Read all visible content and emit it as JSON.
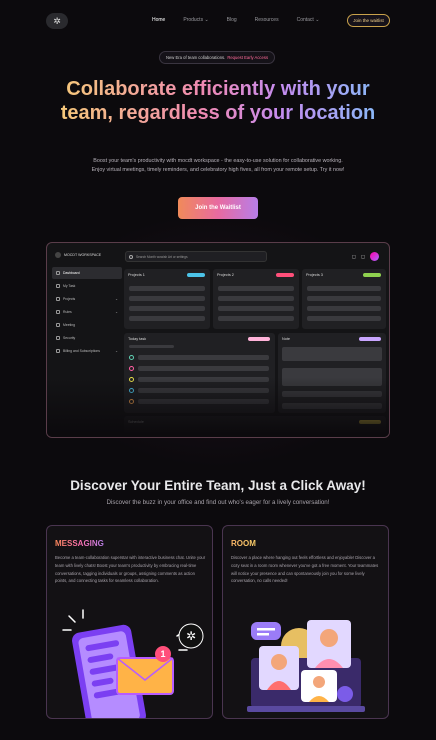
{
  "nav": {
    "logo_glyph": "✲",
    "links": [
      "Home",
      "Products ⌄",
      "Blog",
      "Resources",
      "Contact ⌄"
    ],
    "cta": "Join the waitlist"
  },
  "hero": {
    "pill_text": "New Era of team collaborations.",
    "pill_link": "Request Early Access",
    "title": "Collaborate efficiently with your team, regardless of your location",
    "subtitle": "Boost your team's productivity with mocdt workspace - the easy-to-use solution for collaborative working. Enjoy virtual meetings, timely reminders, and celebratory high fives, all from your remote setup. Try it now!",
    "cta": "Join the Waitlist"
  },
  "dashboard": {
    "workspace": "MOCDT WORKSPACE",
    "sidebar": [
      {
        "label": "Dashboard",
        "chev": ""
      },
      {
        "label": "My Task",
        "chev": ""
      },
      {
        "label": "Projects",
        "chev": "⌄"
      },
      {
        "label": "Rules",
        "chev": "⌄"
      },
      {
        "label": "Meeting",
        "chev": ""
      },
      {
        "label": "Security",
        "chev": ""
      },
      {
        "label": "Billing and Subscriptions",
        "chev": "⌄"
      }
    ],
    "search_placeholder": "Search Month wowish Art or settings",
    "projects": [
      {
        "title": "Projects 1",
        "color": "#4cc3e8"
      },
      {
        "title": "Projects 2",
        "color": "#ff4f7a"
      },
      {
        "title": "Projects 3",
        "color": "#8fd14f"
      }
    ],
    "today_task": "Today task",
    "note": "Note",
    "schedule": "Schedule",
    "today_tag_color": "#ffb3d9",
    "note_tag_color": "#c9a6ff",
    "schedule_tag_color": "#ffe14d",
    "task_dot_colors": [
      "#5fd1b3",
      "#ff5fa2",
      "#e8e04a",
      "#4cc3e8",
      "#f0a050"
    ]
  },
  "discover": {
    "title": "Discover Your Entire Team, Just a Click Away!",
    "subtitle": "Discover the buzz in your office and find out who's eager for a lively conversation!"
  },
  "features": [
    {
      "title": "MESSAGING",
      "text": "Become a team-collaboration superstar with interactive business chat. Unite your team with lively chats! Boost your team's productivity by embracing real-time conversations, tagging individuals or groups, assigning comments as action points, and connecting tasks for seamless collaboration.",
      "badge": "1"
    },
    {
      "title": "ROOM",
      "text": "Discover a place where hanging out feels effortless and enjoyable! Discover a cozy seat in a room room whenever you've got a free moment. Your teammates will notice your presence and can spontaneously join you for some lively conversation, no calls needed!"
    }
  ]
}
